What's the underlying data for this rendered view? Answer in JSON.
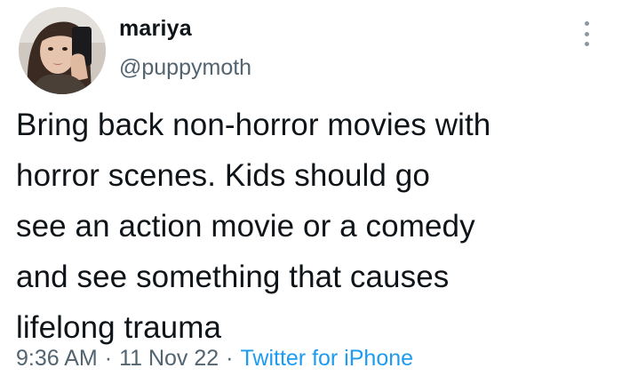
{
  "user": {
    "display_name": "mariya",
    "handle": "@puppymoth"
  },
  "tweet": {
    "lines": [
      "Bring back non-horror movies with",
      "horror scenes. Kids should go",
      "see an action movie or a comedy",
      "and see something that causes",
      "lifelong trauma"
    ]
  },
  "meta": {
    "time": "9:36 AM",
    "separator": "·",
    "date": "11 Nov 22",
    "source": "Twitter for iPhone"
  },
  "colors": {
    "text": "#0f1419",
    "secondary": "#536471",
    "link": "#1d9bf0"
  },
  "icons": {
    "more": "more-vertical-icon"
  }
}
